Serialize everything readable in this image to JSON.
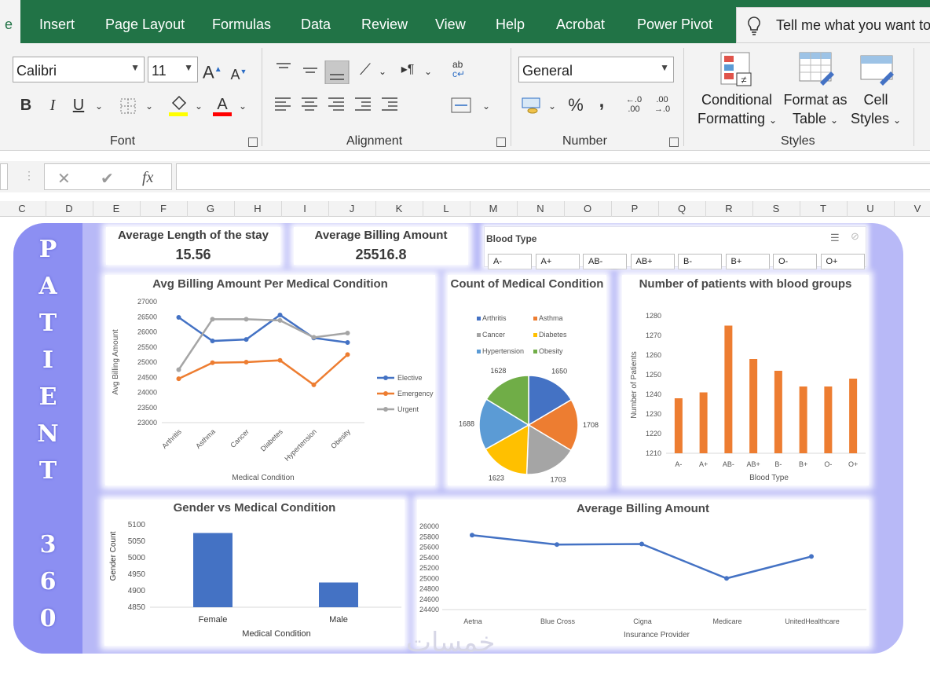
{
  "ribbon": {
    "active_tab": "e",
    "tabs": [
      "Insert",
      "Page Layout",
      "Formulas",
      "Data",
      "Review",
      "View",
      "Help",
      "Acrobat",
      "Power Pivot"
    ],
    "tell_me": "Tell me what you want to",
    "font_name": "Calibri",
    "font_size": "11",
    "number_format": "General",
    "groups": {
      "font": "Font",
      "alignment": "Alignment",
      "number": "Number",
      "styles": "Styles"
    },
    "styles_buttons": {
      "conditional_1": "Conditional",
      "conditional_2": "Formatting",
      "format_1": "Format as",
      "format_2": "Table",
      "cell_1": "Cell",
      "cell_2": "Styles"
    },
    "bold": "B",
    "italic": "I",
    "underline": "U",
    "percent": "%",
    "comma": ",",
    "inc_decimal": "←.0 .00",
    "dec_decimal": ".00 →.0",
    "grow_font": "A",
    "shrink_font": "A"
  },
  "formula_bar": {
    "fx": "fx",
    "cancel": "✕",
    "enter": "✔",
    "value": ""
  },
  "columns": [
    "C",
    "D",
    "E",
    "F",
    "G",
    "H",
    "I",
    "J",
    "K",
    "L",
    "M",
    "N",
    "O",
    "P",
    "Q",
    "R",
    "S",
    "T",
    "U",
    "V"
  ],
  "dashboard": {
    "side_title": [
      "P",
      "A",
      "T",
      "I",
      "E",
      "N",
      "T",
      "3",
      "6",
      "0"
    ],
    "kpi_stay": {
      "title": "Average Length of the stay",
      "value": "15.56"
    },
    "kpi_billing": {
      "title": "Average Billing Amount",
      "value": "25516.8"
    },
    "slicer": {
      "title": "Blood Type",
      "items": [
        "A-",
        "A+",
        "AB-",
        "AB+",
        "B-",
        "B+",
        "O-",
        "O+"
      ]
    },
    "watermark": "خمسات"
  },
  "colors": {
    "blue": "#4472c4",
    "orange": "#ed7d31",
    "gray": "#a5a5a5",
    "yellow": "#ffc000",
    "lightblue": "#5b9bd5",
    "green": "#70ad47",
    "excel_green": "#217346"
  },
  "chart_data": [
    {
      "id": "billing_condition",
      "type": "line",
      "title": "Avg Billing Amount Per Medical Condition",
      "xlabel": "Medical Condition",
      "ylabel": "Avg Billing Amount",
      "ylim": [
        23000,
        27000
      ],
      "yticks": [
        23000,
        23500,
        24000,
        24500,
        25000,
        25500,
        26000,
        26500,
        27000
      ],
      "categories": [
        "Arthritis",
        "Asthma",
        "Cancer",
        "Diabetes",
        "Hypertension",
        "Obesity"
      ],
      "legend": "right",
      "series": [
        {
          "name": "Elective",
          "values": [
            26480,
            25700,
            25750,
            26560,
            25800,
            25650
          ]
        },
        {
          "name": "Emergency",
          "values": [
            24450,
            24980,
            25000,
            25060,
            24250,
            25250
          ]
        },
        {
          "name": "Urgent",
          "values": [
            24750,
            26420,
            26420,
            26380,
            25820,
            25960
          ]
        }
      ]
    },
    {
      "id": "count_condition",
      "type": "pie",
      "title": "Count of Medical Condition",
      "legend": "top",
      "categories": [
        "Arthritis",
        "Asthma",
        "Cancer",
        "Diabetes",
        "Hypertension",
        "Obesity"
      ],
      "values": [
        1650,
        1708,
        1703,
        1623,
        1688,
        1628
      ]
    },
    {
      "id": "blood_groups",
      "type": "bar",
      "title": "Number of patients with blood groups",
      "xlabel": "Blood Type",
      "ylabel": "Number of Patients",
      "ylim": [
        1210,
        1280
      ],
      "yticks": [
        1210,
        1220,
        1230,
        1240,
        1250,
        1260,
        1270,
        1280
      ],
      "categories": [
        "A-",
        "A+",
        "AB-",
        "AB+",
        "B-",
        "B+",
        "O-",
        "O+"
      ],
      "values": [
        1238,
        1241,
        1275,
        1258,
        1252,
        1244,
        1244,
        1248
      ]
    },
    {
      "id": "gender_condition",
      "type": "bar",
      "title": "Gender vs Medical Condition",
      "xlabel": "Medical Condition",
      "ylabel": "Gender Count",
      "ylim": [
        4850,
        5100
      ],
      "yticks": [
        4850,
        4900,
        4950,
        5000,
        5050,
        5100
      ],
      "categories": [
        "Female",
        "Male"
      ],
      "values": [
        5075,
        4925
      ]
    },
    {
      "id": "billing_provider",
      "type": "line",
      "title": "Average Billing Amount",
      "xlabel": "Insurance Provider",
      "ylabel": "",
      "ylim": [
        24400,
        26000
      ],
      "yticks": [
        24400,
        24600,
        24800,
        25000,
        25200,
        25400,
        25600,
        25800,
        26000
      ],
      "categories": [
        "Aetna",
        "Blue Cross",
        "Cigna",
        "Medicare",
        "UnitedHealthcare"
      ],
      "values": [
        25830,
        25650,
        25660,
        25000,
        25420
      ]
    }
  ]
}
